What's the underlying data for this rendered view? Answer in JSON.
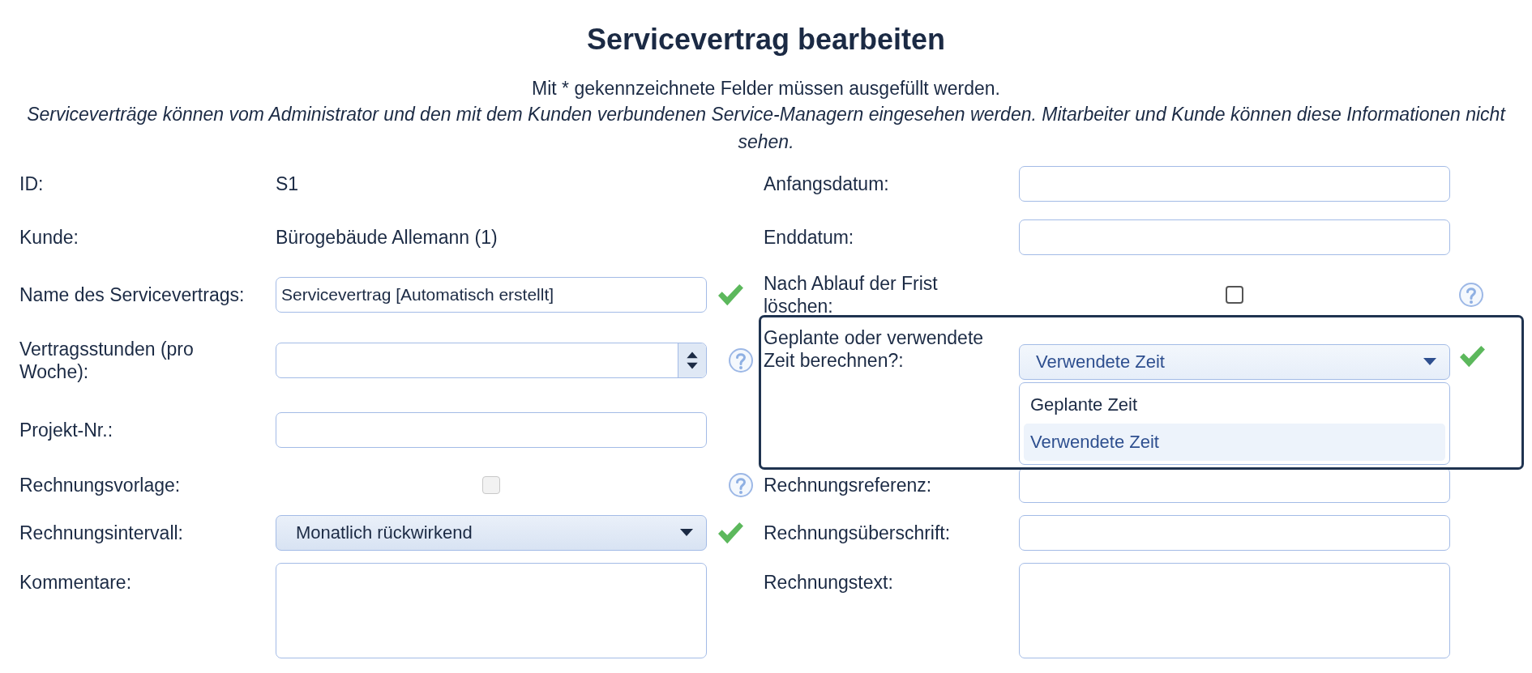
{
  "title": "Servicevertrag bearbeiten",
  "notice": "Mit * gekennzeichnete Felder müssen ausgefüllt werden.",
  "info": "Serviceverträge können vom Administrator und den mit dem Kunden verbundenen Service-Managern eingesehen werden. Mitarbeiter und Kunde können diese Informationen nicht sehen.",
  "left": [
    {
      "label": "ID:",
      "kind": "readonly",
      "value": "S1"
    },
    {
      "label": "Kunde:",
      "kind": "readonly",
      "value": "Bürogebäude Allemann (1)"
    },
    {
      "label": "Name des Servicevertrags:",
      "kind": "input",
      "value": "Servicevertrag [Automatisch erstellt]",
      "valid": true
    },
    {
      "label": "Vertragsstunden (pro Woche):",
      "kind": "number",
      "help": true
    },
    {
      "label": "Projekt-Nr.:",
      "kind": "input"
    },
    {
      "label": "Rechnungsvorlage:",
      "kind": "checkbox",
      "checked": false,
      "disabled": true,
      "help": true
    },
    {
      "label": "Rechnungsintervall:",
      "kind": "select",
      "value": "Monatlich rückwirkend",
      "open": false,
      "valid": true
    },
    {
      "label": "Kommentare:",
      "kind": "textarea"
    }
  ],
  "right": [
    {
      "label": "Anfangsdatum:",
      "kind": "input"
    },
    {
      "label": "Enddatum:",
      "kind": "input"
    },
    {
      "label": "Nach Ablauf der Frist löschen:",
      "kind": "checkbox",
      "checked": false,
      "disabled": false,
      "help": true
    },
    {
      "label": "Geplante oder verwendete Zeit berechnen?:",
      "kind": "select",
      "value": "Verwendete Zeit",
      "open": true,
      "highlighted": true,
      "valid": true,
      "options": [
        {
          "label": "Geplante Zeit",
          "selected": false
        },
        {
          "label": "Verwendete Zeit",
          "selected": true
        }
      ]
    },
    {
      "label": "Rechnungsreferenz:",
      "kind": "input"
    },
    {
      "label": "Rechnungsüberschrift:",
      "kind": "input"
    },
    {
      "label": "Rechnungstext:",
      "kind": "textarea"
    }
  ]
}
